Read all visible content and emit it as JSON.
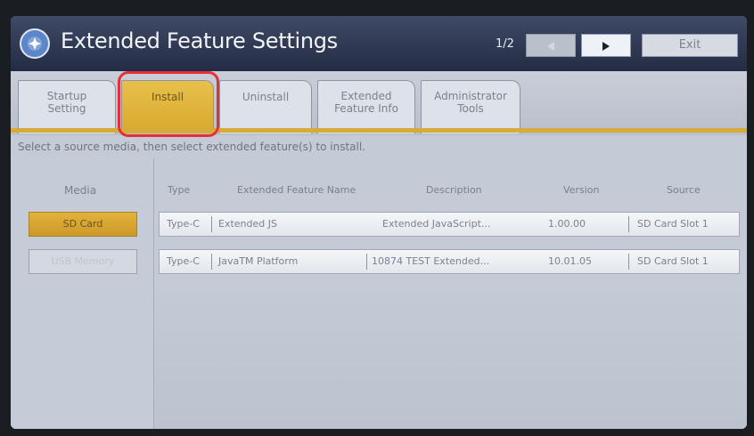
{
  "header": {
    "title": "Extended Feature Settings",
    "page_indicator": "1/2",
    "exit_label": "Exit"
  },
  "tabs": [
    {
      "label_line1": "Startup",
      "label_line2": "Setting",
      "active": false
    },
    {
      "label_line1": "Install",
      "label_line2": "",
      "active": true
    },
    {
      "label_line1": "Uninstall",
      "label_line2": "",
      "active": false
    },
    {
      "label_line1": "Extended",
      "label_line2": "Feature Info",
      "active": false
    },
    {
      "label_line1": "Administrator",
      "label_line2": "Tools",
      "active": false
    }
  ],
  "instruction": "Select a source media, then select extended feature(s) to install.",
  "media": {
    "header": "Media",
    "options": [
      "SD Card",
      "USB Memory"
    ],
    "selected": "SD Card"
  },
  "table": {
    "columns": [
      "Type",
      "Extended Feature Name",
      "Description",
      "Version",
      "Source"
    ],
    "rows": [
      {
        "type": "Type-C",
        "name": "Extended JS",
        "description": "Extended JavaScript...",
        "version": "1.00.00",
        "source": "SD Card Slot 1"
      },
      {
        "type": "Type-C",
        "name": "JavaTM Platform",
        "description": "10874 TEST Extended...",
        "version": "10.01.05",
        "source": "SD Card Slot 1"
      }
    ]
  },
  "colors": {
    "accent": "#d8a92e",
    "header_bg": "#2c3550",
    "highlight": "#e4303a"
  },
  "icons": {
    "logo": "app-logo-icon",
    "prev": "triangle-left-icon",
    "next": "triangle-right-icon"
  }
}
